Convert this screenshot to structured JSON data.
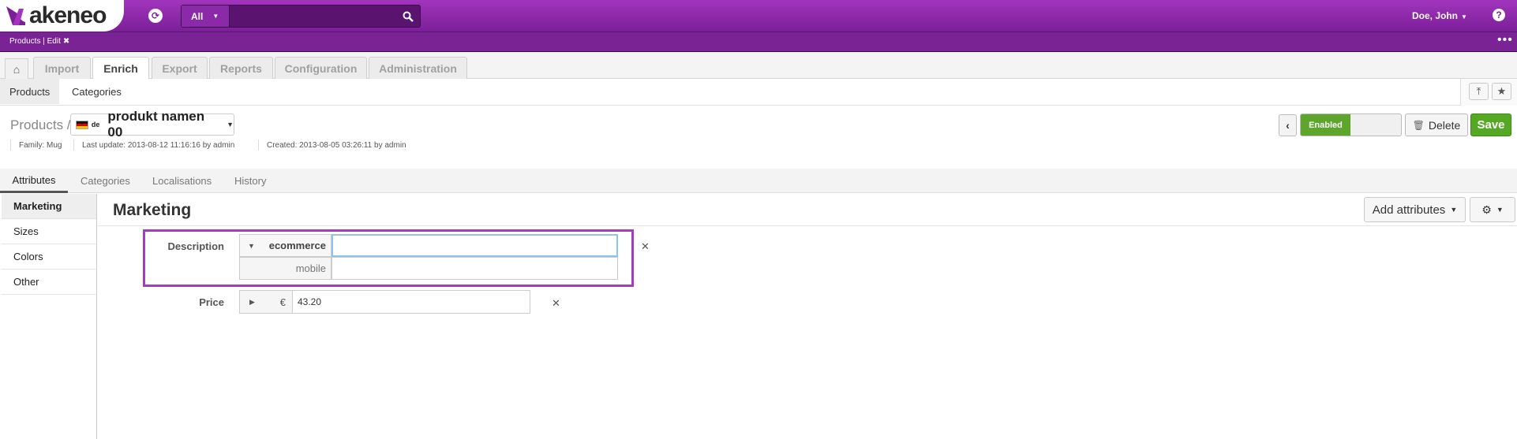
{
  "header": {
    "logo_text": "akeneo",
    "search": {
      "scope": "All",
      "placeholder": ""
    },
    "user": "Doe, John"
  },
  "pinbar": {
    "item": "Products | Edit"
  },
  "main_tabs": [
    "Import",
    "Enrich",
    "Export",
    "Reports",
    "Configuration",
    "Administration"
  ],
  "active_tab": "Enrich",
  "subnav": {
    "items": [
      "Products",
      "Categories"
    ],
    "active": "Products"
  },
  "product": {
    "crumb": "Products /",
    "locale_code": "de",
    "name": "produkt namen 00",
    "family": "Family: Mug",
    "last_update": "Last update: 2013-08-12 11:16:16 by admin",
    "created": "Created: 2013-08-05 03:26:11 by admin"
  },
  "actions": {
    "status": "Enabled",
    "delete": "Delete",
    "save": "Save"
  },
  "section_tabs": [
    "Attributes",
    "Categories",
    "Localisations",
    "History"
  ],
  "groups": [
    "Marketing",
    "Sizes",
    "Colors",
    "Other"
  ],
  "content": {
    "title": "Marketing",
    "add_attributes": "Add attributes",
    "fields": {
      "description": {
        "label": "Description",
        "scopes": [
          {
            "scope": "ecommerce",
            "value": ""
          },
          {
            "scope": "mobile",
            "value": ""
          }
        ]
      },
      "price": {
        "label": "Price",
        "currency": "€",
        "value": "43.20"
      }
    }
  },
  "colors": {
    "brand": "#7b1f98",
    "success": "#54a823",
    "highlight": "#a43dbd"
  }
}
